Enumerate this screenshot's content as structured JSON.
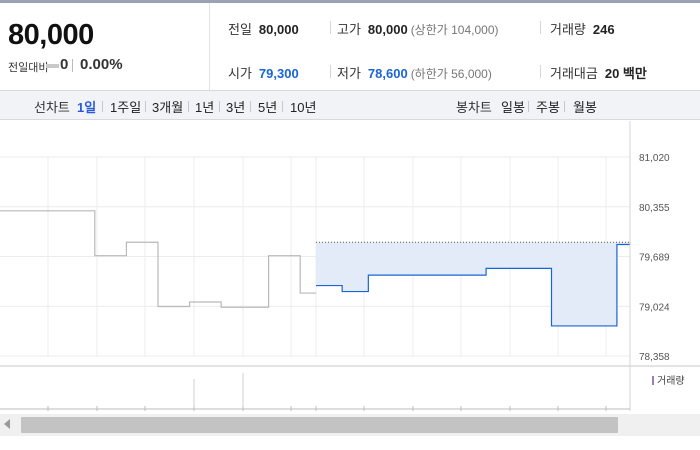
{
  "summary": {
    "current_price": "80,000",
    "compare_label": "전일대비",
    "compare_value": "0",
    "change_rate": "0.00%"
  },
  "stats": {
    "prev_close": {
      "label": "전일",
      "value": "80,000"
    },
    "high": {
      "label": "고가",
      "value": "80,000",
      "limit": "(상한가 104,000)"
    },
    "volume": {
      "label": "거래량",
      "value": "246"
    },
    "open": {
      "label": "시가",
      "value": "79,300"
    },
    "low": {
      "label": "저가",
      "value": "78,600",
      "limit": "(하한가 56,000)"
    },
    "trade_amount": {
      "label": "거래대금",
      "value": "20 백만"
    }
  },
  "colors": {
    "up_down_blue": "#1a64d4",
    "selected_tab": "#2a5bd7",
    "area_fill": "#e3ebf8",
    "volume_marker": "#9a7fbf"
  },
  "tabs": {
    "line_label": "선차트",
    "line_items": [
      "1일",
      "1주일",
      "3개월",
      "1년",
      "3년",
      "5년",
      "10년"
    ],
    "line_selected": "1일",
    "candle_label": "봉차트",
    "candle_items": [
      "일봉",
      "주봉",
      "월봉"
    ]
  },
  "chart_data": {
    "type": "line",
    "y_ticks": [
      "81,020",
      "80,355",
      "79,689",
      "79,024",
      "78,358"
    ],
    "ylim": [
      78358,
      81020
    ],
    "grid": true,
    "volume_legend": "거래량",
    "series": [
      {
        "values": [
          80300,
          80300,
          80300,
          80300,
          80300,
          80300,
          79700,
          79700,
          79880,
          79880,
          79020,
          79020,
          79080,
          79080,
          79010,
          79010,
          79010,
          79700,
          79700,
          79200
        ],
        "style": "gray"
      },
      {
        "values": [
          79300,
          79300,
          79220,
          79220,
          79440,
          79440,
          79440,
          79440,
          79440,
          79440,
          79440,
          79440,
          79440,
          79530,
          79530,
          79530,
          79530,
          79530,
          78760,
          78760,
          78760,
          78760,
          78760,
          79850
        ],
        "style": "blue-area",
        "baseline": 79880
      }
    ]
  }
}
